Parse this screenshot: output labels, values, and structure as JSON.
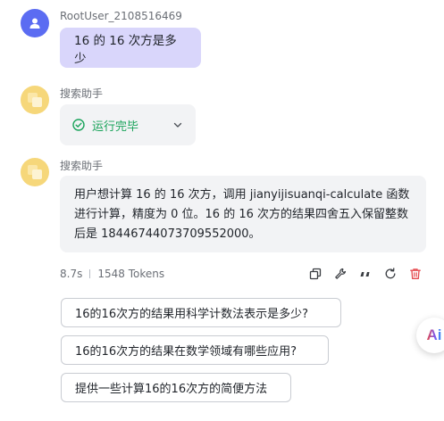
{
  "user": {
    "name": "RootUser_2108516469",
    "message": "16 的 16 次方是多少"
  },
  "assistant": {
    "name": "搜索助手",
    "status": "运行完毕",
    "answer": "用户想计算 16 的 16 次方，调用 jianyijisuanqi-calculate 函数进行计算，精度为 0 位。16 的 16 次方的结果四舍五入保留整数后是 18446744073709552000。",
    "time": "8.7s",
    "tokens": "1548 Tokens"
  },
  "suggestions": [
    "16的16次方的结果用科学计数法表示是多少?",
    "16的16次方的结果在数学领域有哪些应用?",
    "提供一些计算16的16次方的简便方法"
  ],
  "badge": {
    "text": "Ai"
  },
  "colors": {
    "accent": "#5b6cf2",
    "user_bubble": "#d9d6fb",
    "success": "#19a35a",
    "delete": "#e5484d"
  },
  "icons": [
    "user-icon",
    "assistant-logo-icon",
    "check-circle-icon",
    "chevron-down-icon",
    "copy-icon",
    "tool-icon",
    "quote-icon",
    "refresh-icon",
    "delete-icon"
  ]
}
